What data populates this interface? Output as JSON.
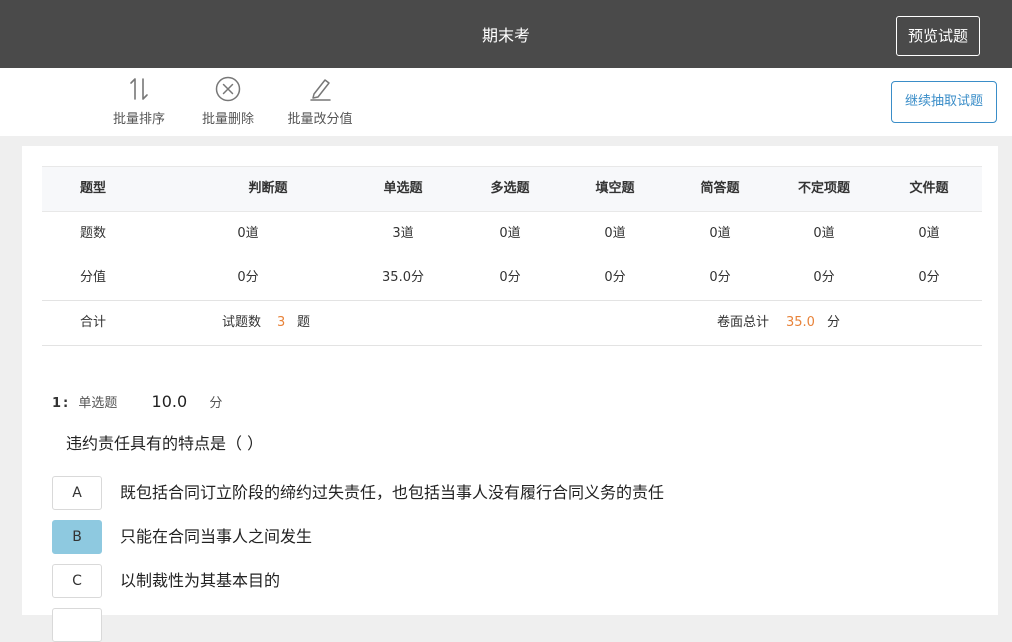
{
  "header": {
    "title": "期末考",
    "preview_label": "预览试题"
  },
  "toolbar": {
    "tools": [
      {
        "label": "批量排序",
        "icon": "sort-icon"
      },
      {
        "label": "批量删除",
        "icon": "delete-circle-icon"
      },
      {
        "label": "批量改分值",
        "icon": "edit-pencil-icon"
      }
    ],
    "continue_label": "继续抽取试题"
  },
  "stats": {
    "columns": [
      "题型",
      "判断题",
      "单选题",
      "多选题",
      "填空题",
      "简答题",
      "不定项题",
      "文件题"
    ],
    "count_row": [
      "题数",
      "0道",
      "3道",
      "0道",
      "0道",
      "0道",
      "0道",
      "0道"
    ],
    "score_row": [
      "分值",
      "0分",
      "35.0分",
      "0分",
      "0分",
      "0分",
      "0分",
      "0分"
    ],
    "summary": {
      "label": "合计",
      "question_count_label": "试题数",
      "question_count": "3",
      "question_unit": "题",
      "total_label": "卷面总计",
      "total_value": "35.0",
      "total_unit": "分"
    }
  },
  "question": {
    "number": "1",
    "colon": ":",
    "type": "单选题",
    "score": "10.0",
    "score_unit": "分",
    "text": "违约责任具有的特点是（ ）",
    "options": [
      {
        "letter": "A",
        "text": "既包括合同订立阶段的缔约过失责任，也包括当事人没有履行合同义务的责任",
        "selected": false
      },
      {
        "letter": "B",
        "text": "只能在合同当事人之间发生",
        "selected": true
      },
      {
        "letter": "C",
        "text": "以制裁性为其基本目的",
        "selected": false
      }
    ]
  },
  "colors": {
    "header_bg": "#4a4a4a",
    "accent_blue": "#3a8dc8",
    "accent_orange": "#e8833a",
    "selected_option": "#8ec9e0"
  }
}
